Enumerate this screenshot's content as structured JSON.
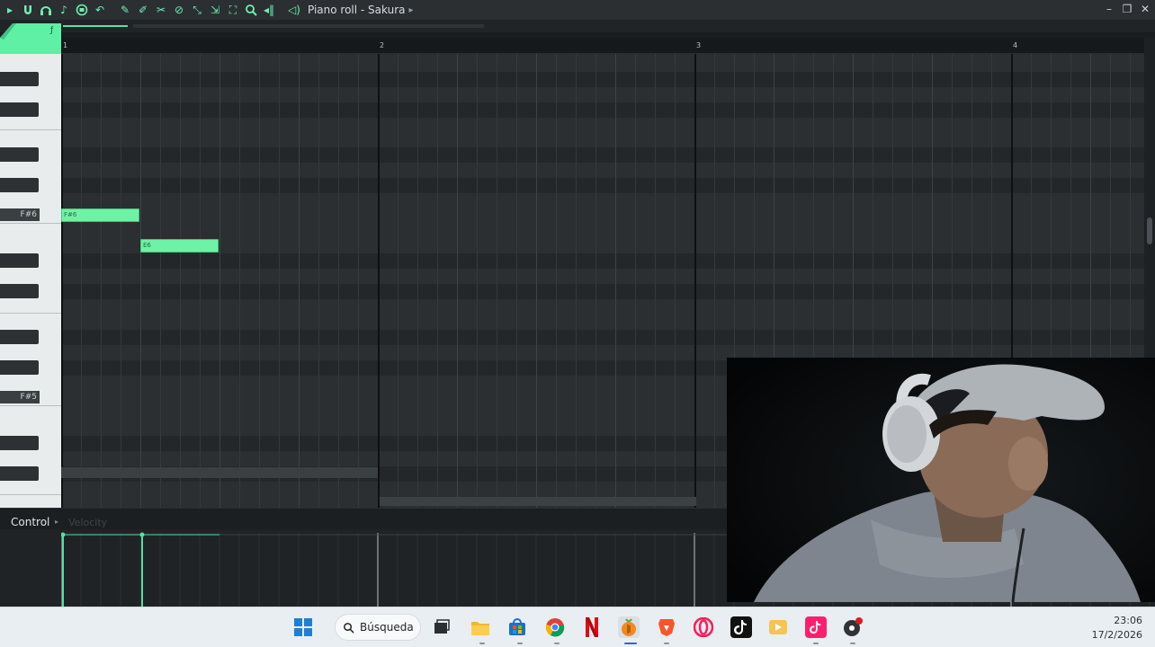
{
  "toolbar": {
    "icons": [
      "play-arrow-icon",
      "magnet-icon",
      "headphones-icon",
      "note-icon",
      "stamp-icon",
      "undo-icon",
      "pencil-icon",
      "brush-icon",
      "slice-icon",
      "mute-icon",
      "select-icon",
      "zoom-icon",
      "playback-icon",
      "speaker-icon"
    ],
    "title": "Piano roll - Sakura",
    "title_arrow": "▸"
  },
  "timeline": {
    "bars": [
      "1",
      "2",
      "3",
      "4"
    ]
  },
  "keyboard": {
    "labels": [
      "F#6",
      "F#5"
    ]
  },
  "notes": [
    {
      "name": "F#6",
      "start_beat": 0,
      "length_beats": 1
    },
    {
      "name": "E6",
      "start_beat": 1,
      "length_beats": 1
    }
  ],
  "control": {
    "label": "Control",
    "arrow": "▸",
    "target": "Velocity"
  },
  "taskbar": {
    "search": "Búsqueda",
    "time": "23:06",
    "date": "17/2/2026"
  },
  "colors": {
    "note_fill": "#6ef2a5",
    "accent": "#55e0a0",
    "grid_bg": "#2b2f31"
  }
}
